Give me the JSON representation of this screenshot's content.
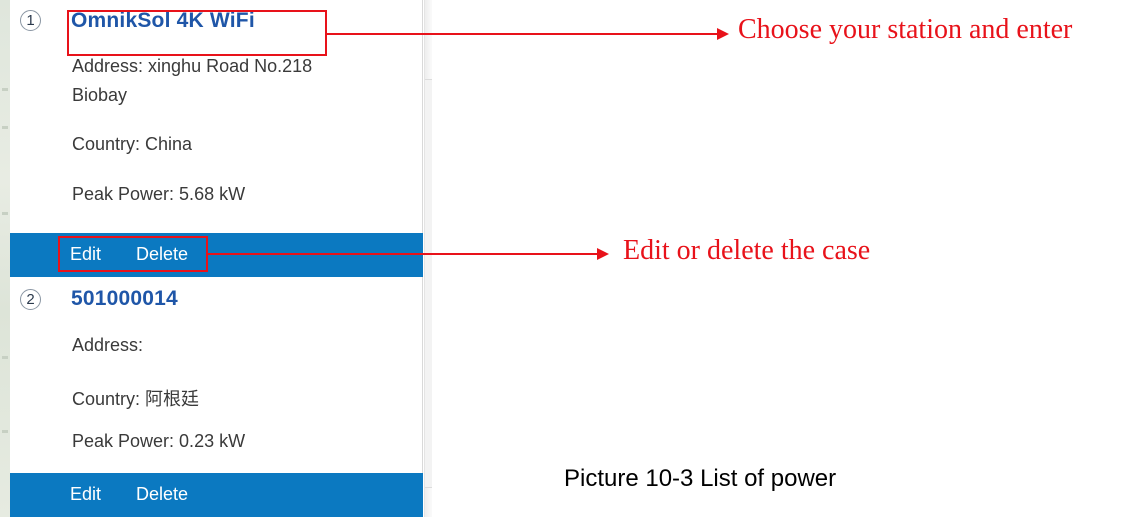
{
  "stations": [
    {
      "number": "1",
      "name": "OmnikSol 4K WiFi",
      "address_line1": "Address: xinghu Road No.218",
      "address_line2": "Biobay",
      "country": "Country: China",
      "peak_power": "Peak Power: 5.68 kW",
      "edit_label": "Edit",
      "delete_label": "Delete"
    },
    {
      "number": "2",
      "name": "501000014",
      "address_line1": "Address:",
      "country": "Country: 阿根廷",
      "peak_power": "Peak Power: 0.23 kW",
      "edit_label": "Edit",
      "delete_label": "Delete"
    }
  ],
  "annotations": {
    "station_callout": "Choose your station and enter",
    "actions_callout": "Edit or delete the case",
    "caption": "Picture 10-3 List of power"
  },
  "colors": {
    "station_name": "#1f56a8",
    "action_bar": "#0b79c1",
    "annotation_red": "#e8121a"
  }
}
